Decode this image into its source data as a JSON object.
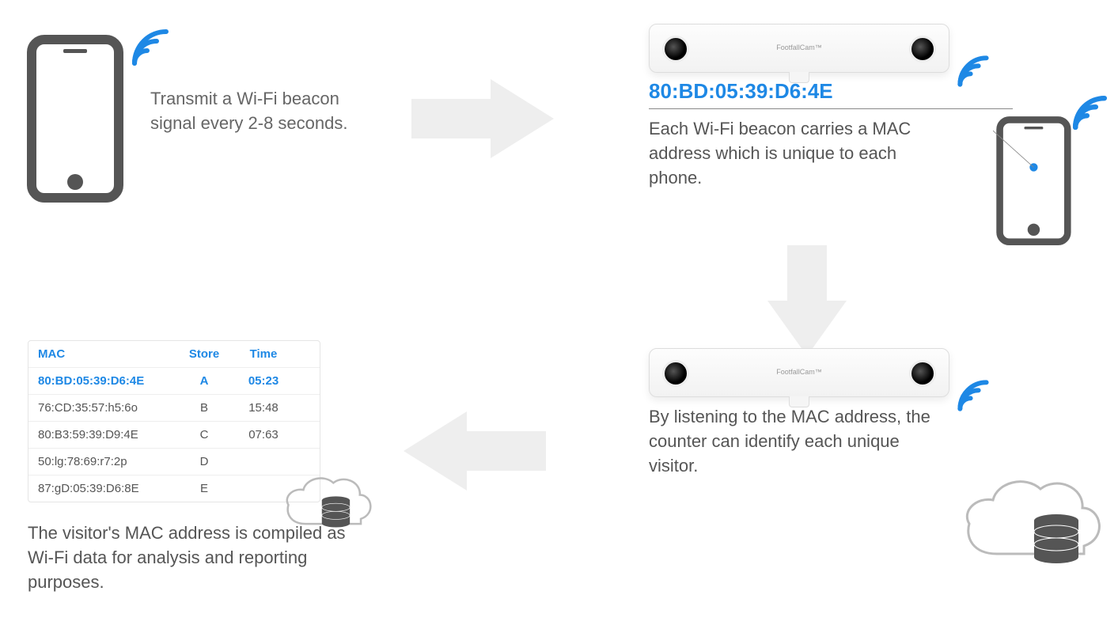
{
  "colors": {
    "accent": "#1e88e5",
    "muted": "#555",
    "arrow": "#eeeeee",
    "icon": "#555"
  },
  "stage1": {
    "text": "Transmit a Wi-Fi beacon signal every 2-8 seconds."
  },
  "stage2": {
    "mac": "80:BD:05:39:D6:4E",
    "text": "Each Wi-Fi beacon carries a MAC address which is unique to each phone.",
    "device_brand": "FootfallCam™"
  },
  "stage3": {
    "text": "By listening to the MAC address, the counter can identify each unique visitor.",
    "device_brand": "FootfallCam™"
  },
  "stage4": {
    "headers": {
      "mac": "MAC",
      "store": "Store",
      "time": "Time"
    },
    "rows": [
      {
        "mac": "80:BD:05:39:D6:4E",
        "store": "A",
        "time": "05:23",
        "highlight": true
      },
      {
        "mac": "76:CD:35:57:h5:6o",
        "store": "B",
        "time": "15:48",
        "highlight": false
      },
      {
        "mac": "80:B3:59:39:D9:4E",
        "store": "C",
        "time": "07:63",
        "highlight": false
      },
      {
        "mac": "50:lg:78:69:r7:2p",
        "store": "D",
        "time": "",
        "highlight": false
      },
      {
        "mac": "87:gD:05:39:D6:8E",
        "store": "E",
        "time": "",
        "highlight": false
      }
    ],
    "text": "The visitor's MAC address is compiled as Wi-Fi data for analysis and reporting purposes."
  }
}
